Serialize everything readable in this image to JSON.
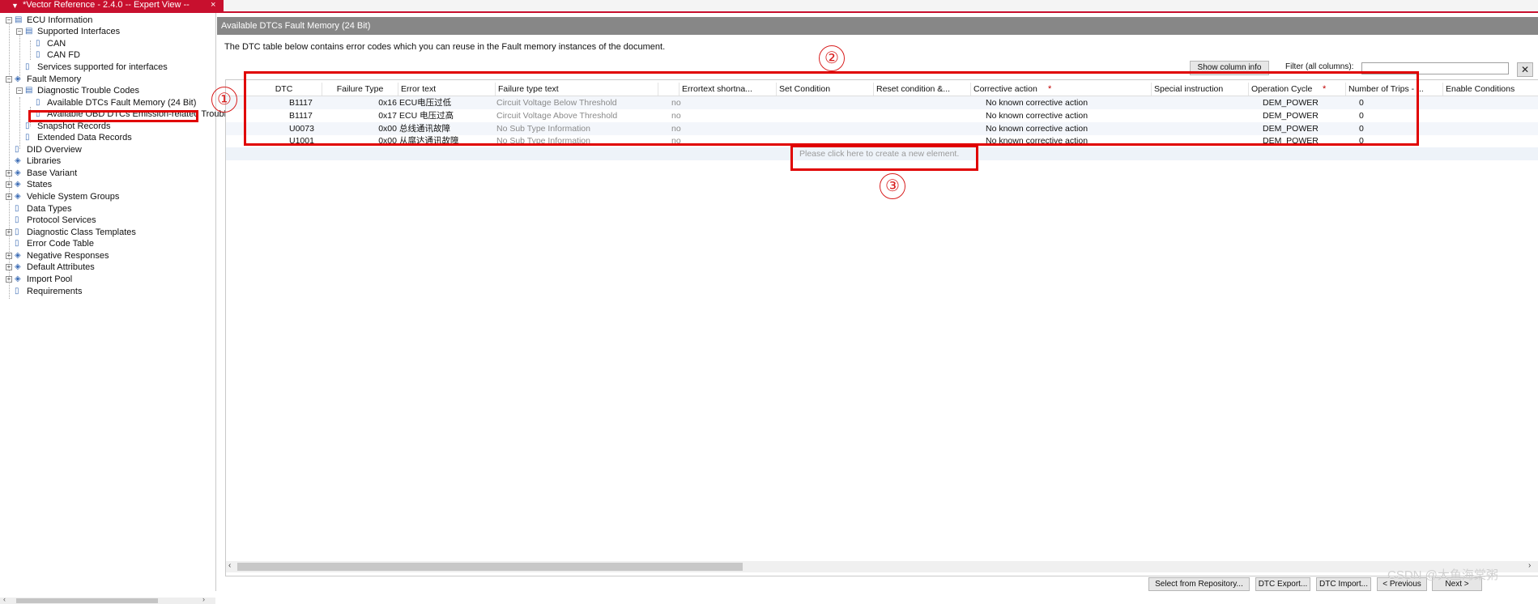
{
  "window": {
    "title": "*Vector Reference - 2.4.0 -- Expert View --",
    "close": "×"
  },
  "tree": {
    "items": [
      {
        "label": "ECU Information"
      },
      {
        "label": "Supported Interfaces"
      },
      {
        "label": "CAN"
      },
      {
        "label": "CAN FD"
      },
      {
        "label": "Services supported for interfaces"
      },
      {
        "label": "Fault Memory"
      },
      {
        "label": "Diagnostic Trouble Codes"
      },
      {
        "label": "Available DTCs Fault Memory (24 Bit)"
      },
      {
        "label": "Available OBD DTCs Emission-related Trouble"
      },
      {
        "label": "Snapshot Records"
      },
      {
        "label": "Extended Data Records"
      },
      {
        "label": "DID Overview"
      },
      {
        "label": "Libraries"
      },
      {
        "label": "Base Variant"
      },
      {
        "label": "States"
      },
      {
        "label": "Vehicle System Groups"
      },
      {
        "label": "Data Types"
      },
      {
        "label": "Protocol Services"
      },
      {
        "label": "Diagnostic Class Templates"
      },
      {
        "label": "Error Code Table"
      },
      {
        "label": "Negative Responses"
      },
      {
        "label": "Default Attributes"
      },
      {
        "label": "Import Pool"
      },
      {
        "label": "Requirements"
      }
    ]
  },
  "panel": {
    "title": "Available DTCs Fault Memory (24 Bit)",
    "description": "The DTC table below contains error codes which you can reuse in the Fault memory instances of the document.",
    "show_column_info": "Show column info",
    "filter_label": "Filter (all columns):",
    "filter_value": "",
    "clear_glyph": "✕"
  },
  "table": {
    "columns": [
      "DTC",
      "Failure Type",
      "Error text",
      "Failure type text",
      "",
      "Errortext shortna...",
      "Set Condition",
      "Reset condition &...",
      "Corrective action",
      "Special instruction",
      "Operation Cycle",
      "Number of Trips - ...",
      "Enable Conditions"
    ],
    "required_mark": "*",
    "rows": [
      {
        "dtc": "B1117",
        "failure_type": "0x16",
        "error_text": "ECU电压过低",
        "failure_type_text": "Circuit Voltage Below Threshold",
        "flag": "no",
        "corrective_action": "No known corrective action",
        "operation_cycle": "DEM_POWER",
        "trips": "0"
      },
      {
        "dtc": "B1117",
        "failure_type": "0x17",
        "error_text": "ECU 电压过高",
        "failure_type_text": "Circuit Voltage Above Threshold",
        "flag": "no",
        "corrective_action": "No known corrective action",
        "operation_cycle": "DEM_POWER",
        "trips": "0"
      },
      {
        "dtc": "U0073",
        "failure_type": "0x00",
        "error_text": "总线通讯故障",
        "failure_type_text": "No Sub Type Information",
        "flag": "no",
        "corrective_action": "No known corrective action",
        "operation_cycle": "DEM_POWER",
        "trips": "0"
      },
      {
        "dtc": "U1001",
        "failure_type": "0x00",
        "error_text": "从腐达通讯故障",
        "failure_type_text": "No Sub Type Information",
        "flag": "no",
        "corrective_action": "No known corrective action",
        "operation_cycle": "DEM_POWER",
        "trips": "0"
      }
    ],
    "new_element_hint": "Please click here to create a new element."
  },
  "buttons": {
    "select_repo": "Select from Repository...",
    "dtc_export": "DTC Export...",
    "dtc_import": "DTC Import...",
    "previous": "< Previous",
    "next": "Next >"
  },
  "annotations": {
    "one": "①",
    "two": "②",
    "three": "③"
  },
  "watermark": "CSDN @大鱼海棠粥",
  "colors": {
    "accent": "#c8102e",
    "annotation": "#e00000",
    "header": "#878787"
  }
}
